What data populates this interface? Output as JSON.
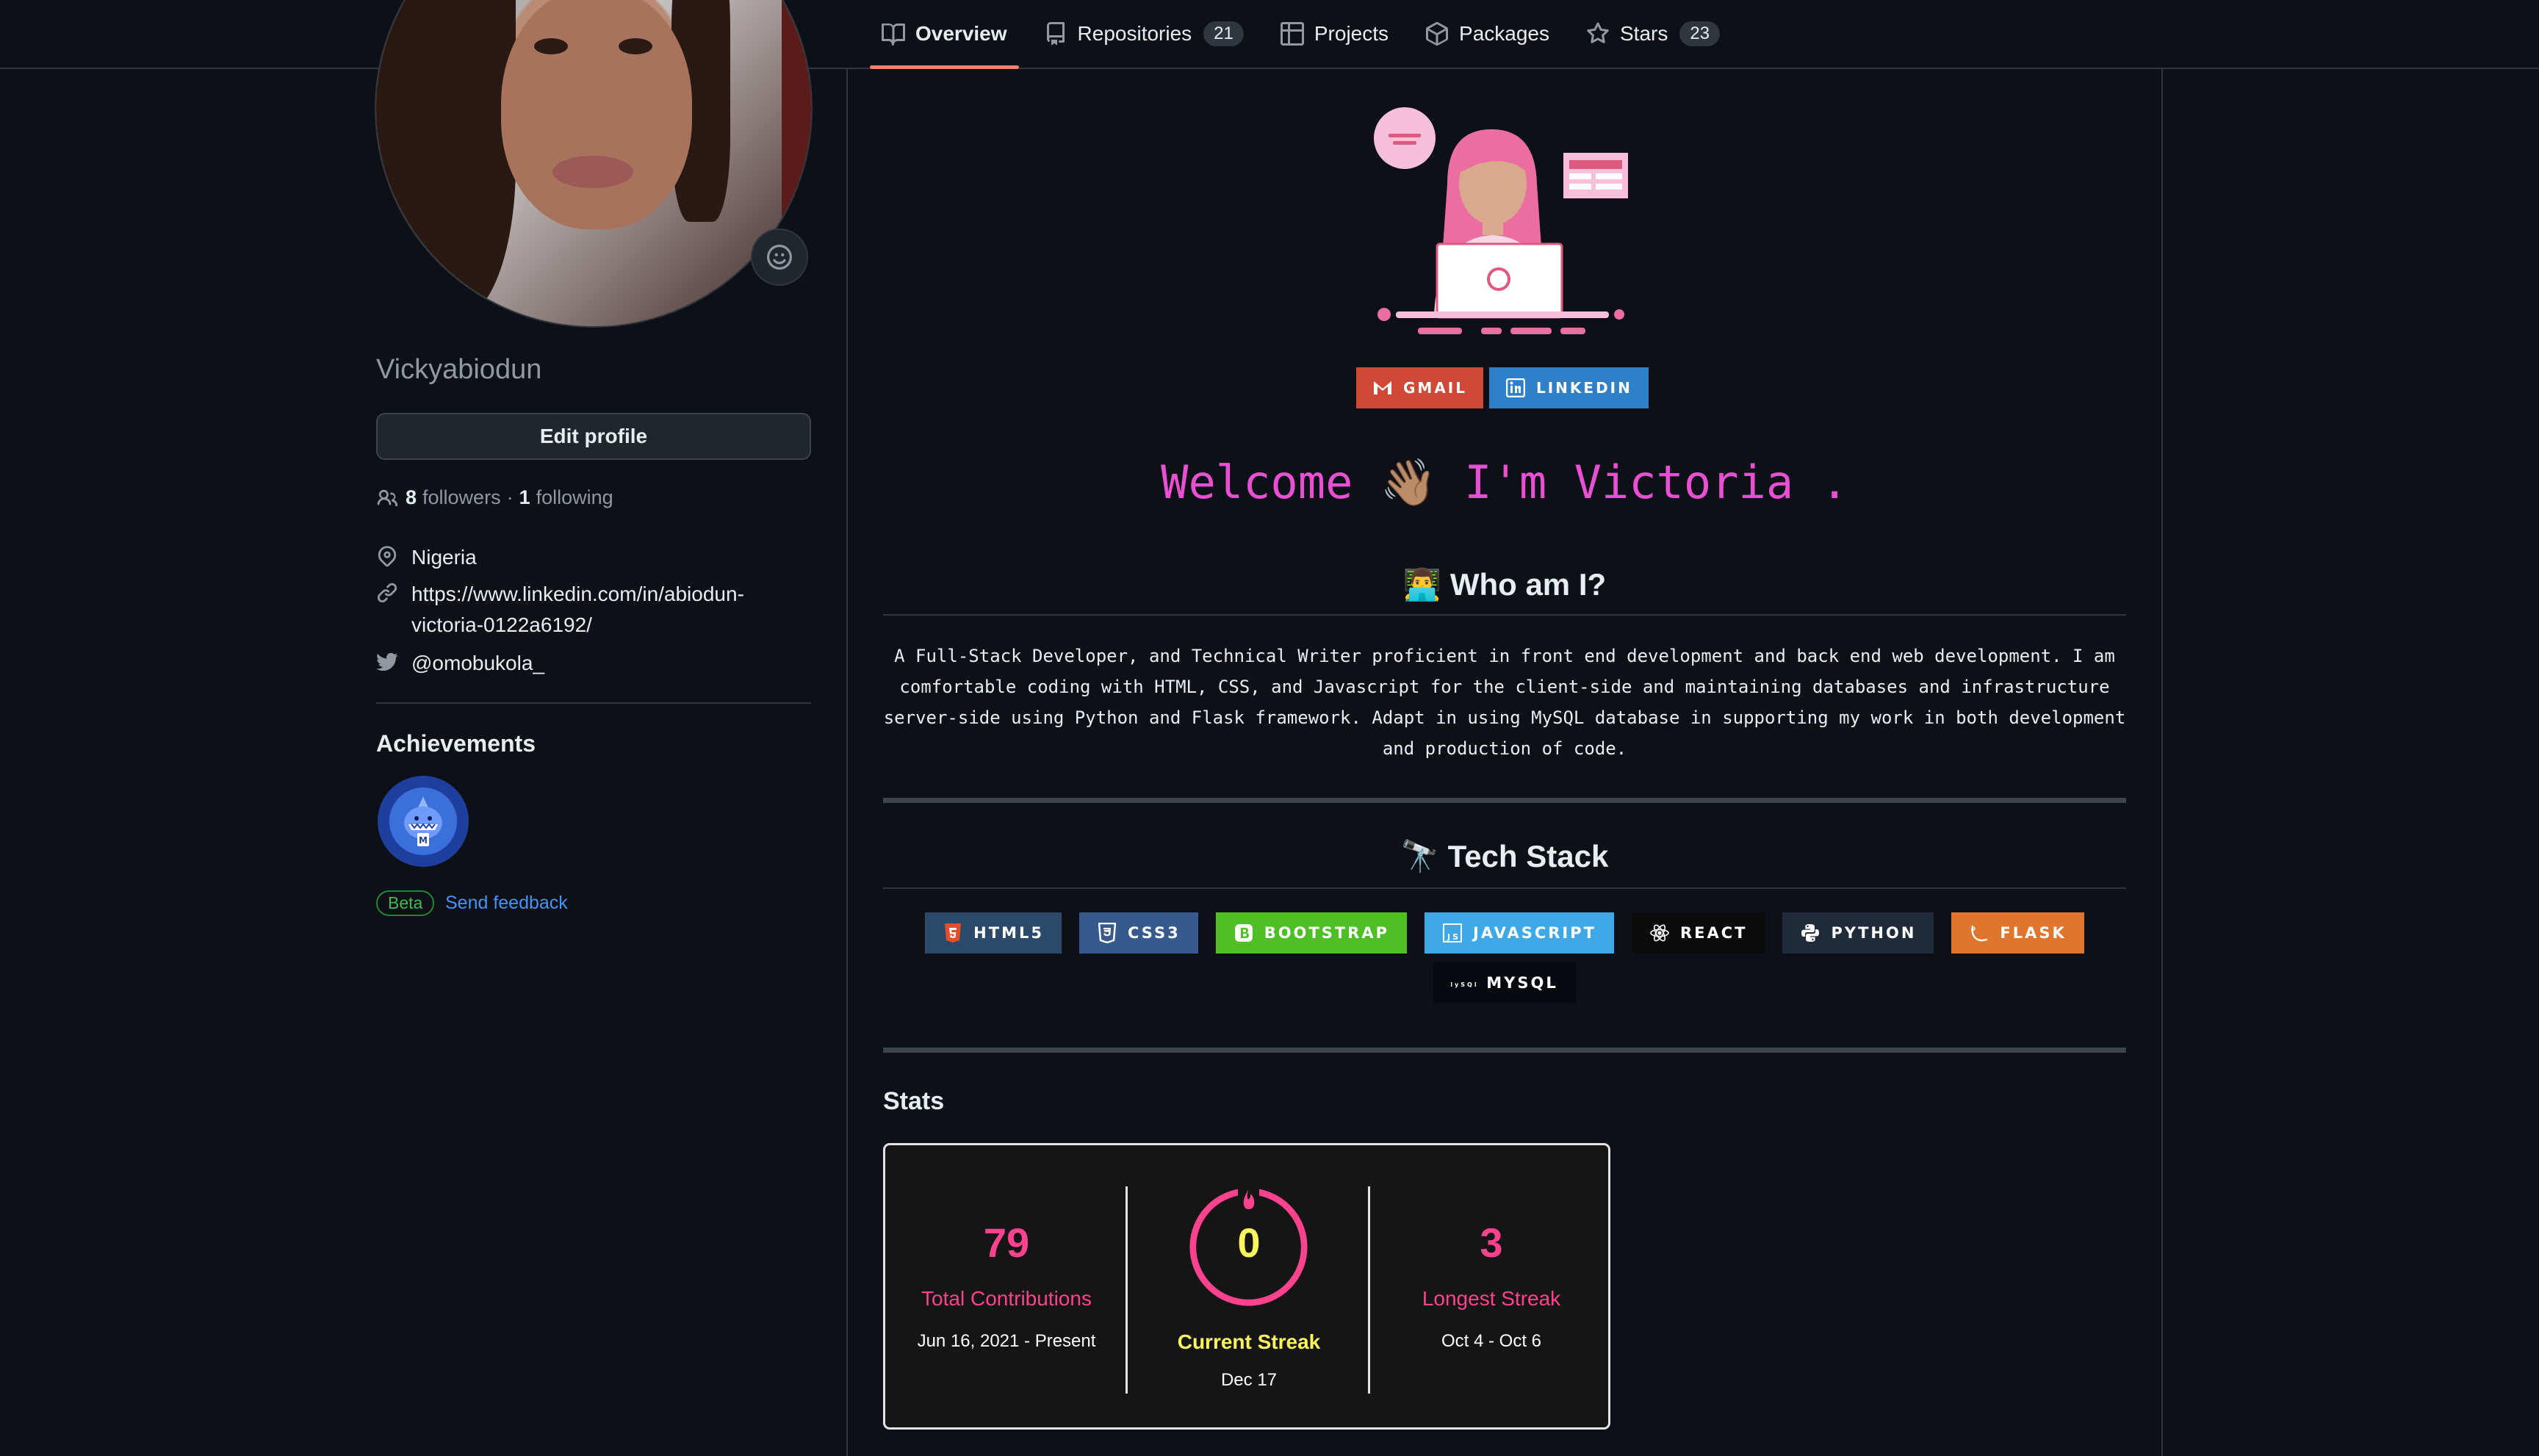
{
  "nav": {
    "tabs": [
      {
        "label": "Overview",
        "count": null,
        "active": true
      },
      {
        "label": "Repositories",
        "count": "21",
        "active": false
      },
      {
        "label": "Projects",
        "count": null,
        "active": false
      },
      {
        "label": "Packages",
        "count": null,
        "active": false
      },
      {
        "label": "Stars",
        "count": "23",
        "active": false
      }
    ]
  },
  "profile": {
    "username": "Vickyabiodun",
    "edit_label": "Edit profile",
    "followers_count": "8",
    "followers_label": "followers",
    "following_count": "1",
    "following_label": "following",
    "separator": "·",
    "location": "Nigeria",
    "website_line1": "https://www.linkedin.com/in/abiodun-",
    "website_line2": "victoria-0122a6192/",
    "twitter": "@omobukola_",
    "achievements_title": "Achievements",
    "beta_label": "Beta",
    "feedback_label": "Send feedback"
  },
  "readme": {
    "contact": [
      {
        "label": "GMAIL",
        "color": "#D14836",
        "icon": "gmail-icon"
      },
      {
        "label": "LINKEDIN",
        "color": "#0077B5",
        "icon": "linkedin-icon"
      }
    ],
    "welcome": "Welcome 👋🏽 I'm Victoria .",
    "who_title": "👨‍💻 Who am I?",
    "bio_lines": [
      "A Full-Stack Developer, and Technical Writer proficient in front end development and back end web development. I am",
      "comfortable coding with HTML, CSS, and Javascript for the client-side and maintaining databases and infrastructure",
      "server-side using Python and Flask framework. Adapt in using MySQL database in supporting my work in both development",
      "and production of code."
    ],
    "tech_title": "🔭 Tech Stack",
    "tech": [
      {
        "label": "HTML5",
        "color": "#2b4a6a",
        "icon": "html5-icon",
        "icon_color": "#E34F26"
      },
      {
        "label": "CSS3",
        "color": "#375a8c",
        "icon": "css3-icon",
        "icon_color": "#ffffff"
      },
      {
        "label": "BOOTSTRAP",
        "color": "#4fbf26",
        "icon": "bootstrap-icon",
        "icon_color": "#ffffff"
      },
      {
        "label": "JAVASCRIPT",
        "color": "#3fa9e8",
        "icon": "javascript-icon",
        "icon_color": "#ffffff"
      },
      {
        "label": "REACT",
        "color": "#0b0b0b",
        "icon": "react-icon",
        "icon_color": "#ffffff"
      },
      {
        "label": "PYTHON",
        "color": "#1f2a3a",
        "icon": "python-icon",
        "icon_color": "#ffffff"
      },
      {
        "label": "FLASK",
        "color": "#e0762e",
        "icon": "flask-icon",
        "icon_color": "#ffffff"
      },
      {
        "label": "MYSQL",
        "color": "#06090d",
        "icon": "mysql-icon",
        "icon_color": "#ffffff",
        "icon_text": "MySQL"
      }
    ],
    "stats_title": "Stats",
    "stats": {
      "total": {
        "value": "79",
        "label": "Total Contributions",
        "range": "Jun 16, 2021 - Present"
      },
      "current": {
        "value": "0",
        "label": "Current Streak",
        "range": "Dec 17"
      },
      "longest": {
        "value": "3",
        "label": "Longest Streak",
        "range": "Oct 4 - Oct 6"
      },
      "accent": "#fe428e",
      "streak_accent": "#fef65b"
    }
  }
}
